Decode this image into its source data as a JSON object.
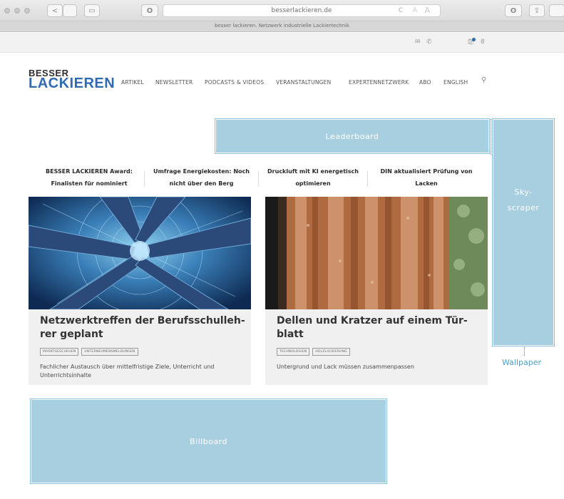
{
  "browser": {
    "url": "besserlackieren.de",
    "tab_title": "besser lackieren. Netzwerk industrielle Lackiertechnik",
    "reader_icon": "A",
    "reload_icon": "C",
    "shield_icon": "O",
    "back_icon": "<",
    "sidebar_icon": "▭"
  },
  "utility": {
    "mail_icon": "✉",
    "phone_icon": "✆",
    "cart_icon": "🛍",
    "user_icon": "8"
  },
  "header": {
    "logo_line1": "BESSER",
    "logo_line2": "LACKIEREN",
    "nav": [
      "ARTIKEL",
      "NEWSLETTER",
      "PODCASTS & VIDEOS",
      "VERANSTALTUNGEN",
      "EXPERTENNETZWERK",
      "ABO",
      "ENGLISH"
    ],
    "search_icon": "⚲"
  },
  "ads": {
    "leaderboard": "Leaderboard",
    "skyscraper_line1": "Sky-",
    "skyscraper_line2": "scraper",
    "billboard": "Billboard",
    "wallpaper": "Wallpaper"
  },
  "ticker": [
    {
      "line1": "BESSER LACKIEREN Award:",
      "line2": "Finalisten für nominiert"
    },
    {
      "line1": "Umfrage Energiekosten: Noch",
      "line2": "nicht über den Berg"
    },
    {
      "line1": "Druckluft mit KI energetisch",
      "line2": "optimieren"
    },
    {
      "line1": "DIN aktualisiert Prüfung von",
      "line2": "Lacken"
    }
  ],
  "articles": [
    {
      "title_line1": "Netzwerktreffen der Berufsschulleh-",
      "title_line2": "rer geplant",
      "tags": [
        "MARKTGESCHEHEN",
        "UNTERNEHMENSMELDUNGEN"
      ],
      "desc_line1": "Fachlicher Austausch über mittelfristige Ziele, Unterricht und",
      "desc_line2": "Unterrichtsinhalte"
    },
    {
      "title_line1": "Dellen und Kratzer auf einem Tür-",
      "title_line2": "blatt",
      "tags": [
        "TECHNOLOGIEN",
        "HOLZLACKIERUNG"
      ],
      "desc_line1": "Untergrund und Lack müssen zusammenpassen",
      "desc_line2": ""
    }
  ]
}
